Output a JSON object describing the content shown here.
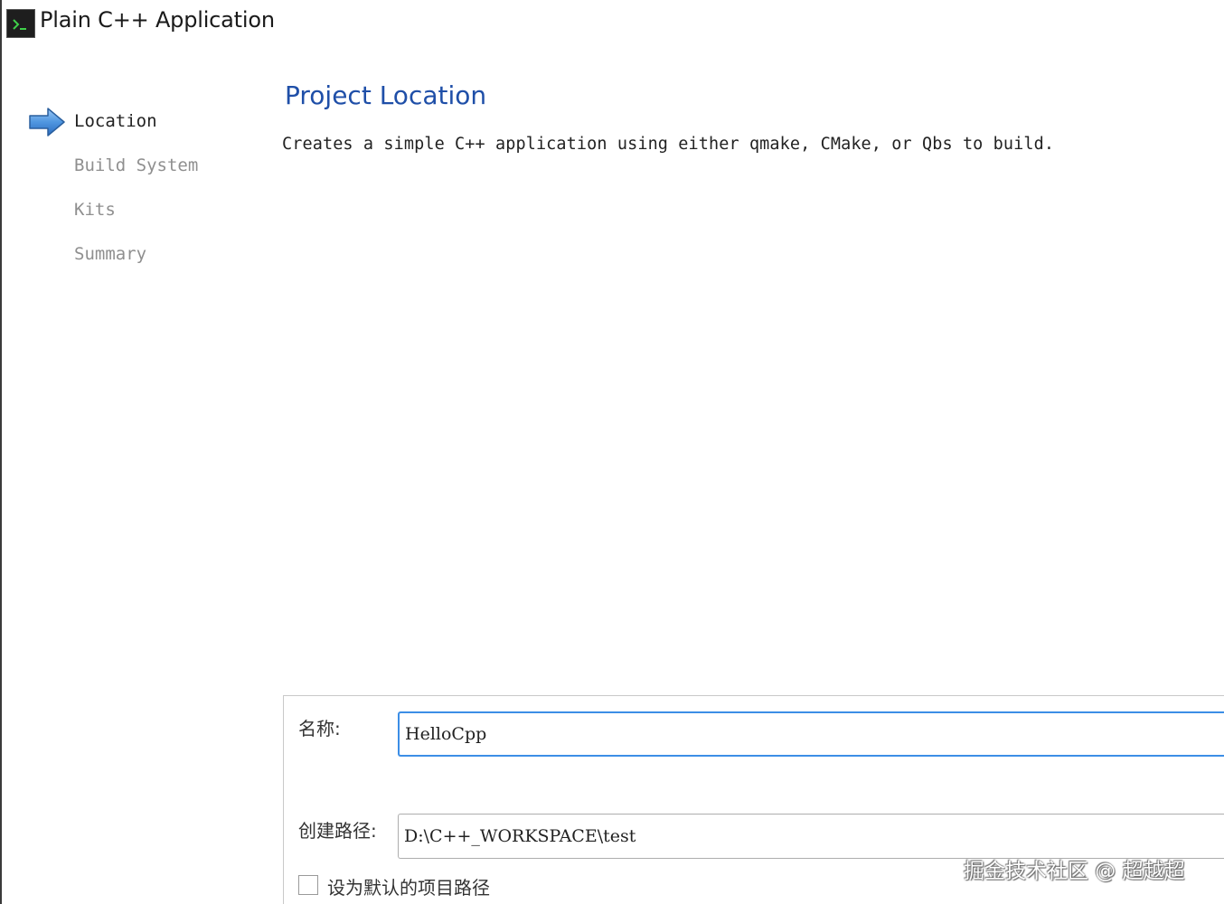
{
  "window": {
    "title": "Plain C++ Application",
    "icon": "terminal-icon"
  },
  "wizard": {
    "current_step_icon": "arrow-right-icon",
    "steps": [
      {
        "label": "Location",
        "state": "current"
      },
      {
        "label": "Build System",
        "state": "pending"
      },
      {
        "label": "Kits",
        "state": "pending"
      },
      {
        "label": "Summary",
        "state": "pending"
      }
    ]
  },
  "page": {
    "title": "Project Location",
    "description": "Creates a simple C++ application using either qmake, CMake, or Qbs to build."
  },
  "form": {
    "name_label": "名称:",
    "name_value": "HelloCpp",
    "path_label": "创建路径:",
    "path_value": "D:\\C++_WORKSPACE\\test",
    "default_checkbox_label": "设为默认的项目路径",
    "default_checkbox_checked": false
  },
  "watermark": "掘金技术社区 @ 超越超",
  "colors": {
    "title_blue": "#1f4fa8",
    "focus_border": "#3c8ee6",
    "inactive_step": "#8f8f8f"
  }
}
